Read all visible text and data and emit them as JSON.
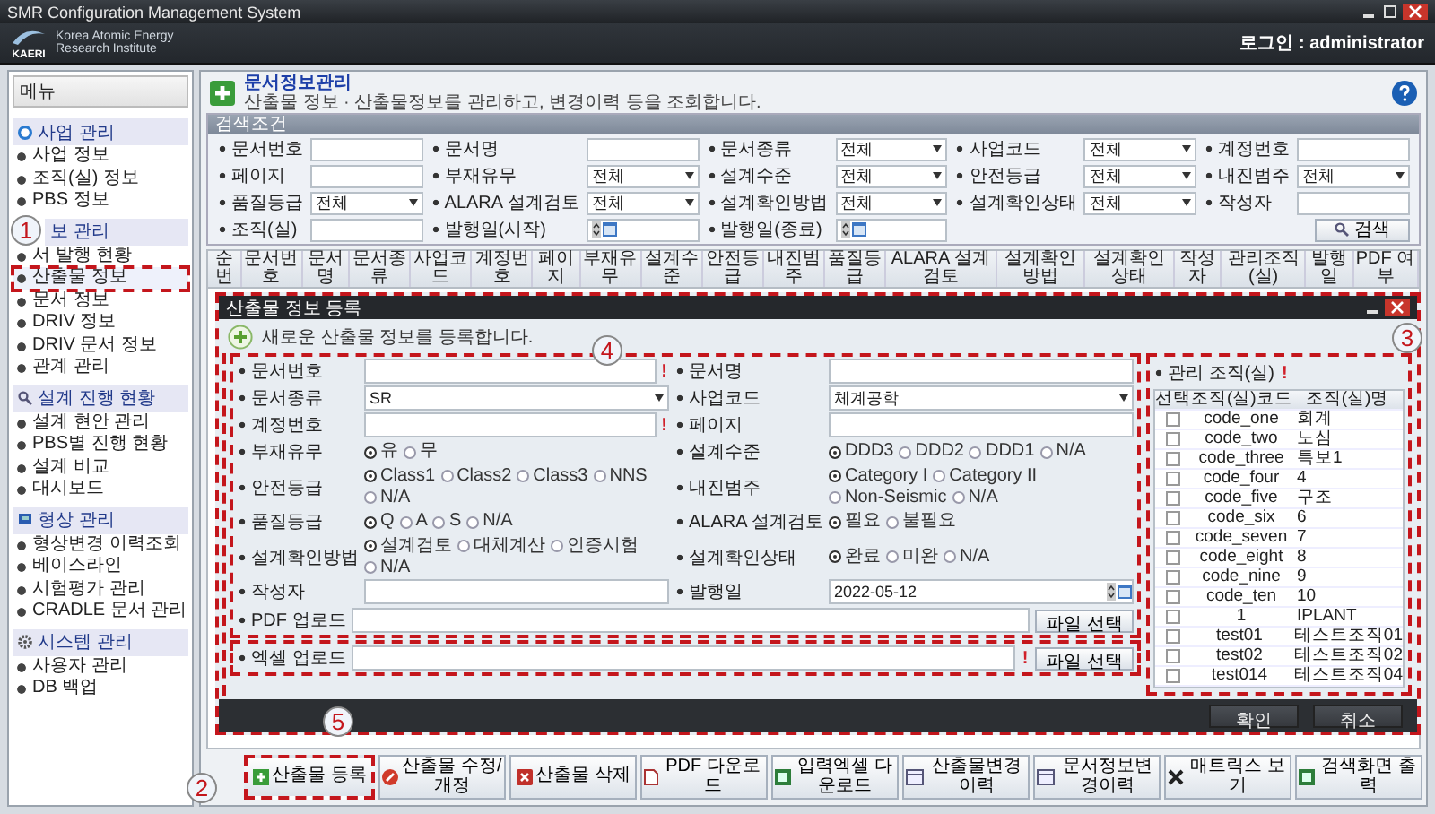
{
  "window": {
    "title": "SMR Configuration Management System"
  },
  "header": {
    "logo_text": "KAERI",
    "org": "Korea Atomic Energy Research Institute",
    "login": "로그인 : administrator"
  },
  "sidebar": {
    "title": "메뉴",
    "groups": [
      {
        "label": "사업 관리",
        "kind": "circle",
        "items": [
          {
            "label": "사업 정보",
            "selected": false,
            "highlighted": false
          },
          {
            "label": "조직(실) 정보",
            "selected": false,
            "highlighted": false
          },
          {
            "label": "PBS 정보",
            "selected": false,
            "highlighted": false
          }
        ]
      },
      {
        "label": "보 관리",
        "kind": "none",
        "items": [
          {
            "label": "서 발행 현황",
            "selected": false,
            "highlighted": false
          },
          {
            "label": "산출물 정보",
            "selected": true,
            "highlighted": true
          },
          {
            "label": "문서 정보",
            "selected": false,
            "highlighted": false
          },
          {
            "label": "DRIV 정보",
            "selected": false,
            "highlighted": false
          },
          {
            "label": "DRIV 문서 정보",
            "selected": false,
            "highlighted": false
          },
          {
            "label": "관계 관리",
            "selected": false,
            "highlighted": false
          }
        ]
      },
      {
        "label": "설계 진행 현황",
        "kind": "search",
        "items": [
          {
            "label": "설계 현안 관리",
            "selected": false,
            "highlighted": false
          },
          {
            "label": "PBS별 진행 현황",
            "selected": false,
            "highlighted": false
          },
          {
            "label": "설계 비교",
            "selected": false,
            "highlighted": false
          },
          {
            "label": "대시보드",
            "selected": false,
            "highlighted": false
          }
        ]
      },
      {
        "label": "형상 관리",
        "kind": "monitor",
        "items": [
          {
            "label": "형상변경 이력조회",
            "selected": false,
            "highlighted": false
          },
          {
            "label": "베이스라인",
            "selected": false,
            "highlighted": false
          },
          {
            "label": "시험평가 관리",
            "selected": false,
            "highlighted": false
          },
          {
            "label": "CRADLE 문서 관리",
            "selected": false,
            "highlighted": false
          }
        ]
      },
      {
        "label": "시스템 관리",
        "kind": "gear",
        "items": [
          {
            "label": "사용자 관리",
            "selected": false,
            "highlighted": false
          },
          {
            "label": "DB 백업",
            "selected": false,
            "highlighted": false
          }
        ]
      }
    ]
  },
  "page": {
    "title": "문서정보관리",
    "subtitle": "산출물 정보 · 산출물정보를 관리하고, 변경이력 등을 조회합니다."
  },
  "search": {
    "title": "검색조건",
    "button": "검색",
    "fields": [
      {
        "label": "문서번호",
        "kind": "text"
      },
      {
        "label": "문서명",
        "kind": "text"
      },
      {
        "label": "문서종류",
        "kind": "select",
        "value": "전체"
      },
      {
        "label": "사업코드",
        "kind": "select",
        "value": "전체"
      },
      {
        "label": "계정번호",
        "kind": "text"
      },
      {
        "label": "페이지",
        "kind": "text"
      },
      {
        "label": "부재유무",
        "kind": "select",
        "value": "전체"
      },
      {
        "label": "설계수준",
        "kind": "select",
        "value": "전체"
      },
      {
        "label": "안전등급",
        "kind": "select",
        "value": "전체"
      },
      {
        "label": "내진범주",
        "kind": "select",
        "value": "전체"
      },
      {
        "label": "품질등급",
        "kind": "select",
        "value": "전체"
      },
      {
        "label": "ALARA 설계검토",
        "kind": "select",
        "value": "전체"
      },
      {
        "label": "설계확인방법",
        "kind": "select",
        "value": "전체"
      },
      {
        "label": "설계확인상태",
        "kind": "select",
        "value": "전체"
      },
      {
        "label": "작성자",
        "kind": "text"
      },
      {
        "label": "조직(실)",
        "kind": "text"
      },
      {
        "label": "발행일(시작)",
        "kind": "date"
      },
      {
        "label": "발행일(종료)",
        "kind": "date"
      }
    ]
  },
  "table": {
    "columns": [
      "순번",
      "문서번호",
      "문서명",
      "문서종류",
      "사업코드",
      "계정번호",
      "페이지",
      "부재유무",
      "설계수준",
      "안전등급",
      "내진범주",
      "품질등급",
      "ALARA 설계검토",
      "설계확인방법",
      "설계확인상태",
      "작성자",
      "관리조직(실)",
      "발행일",
      "PDF 여부"
    ]
  },
  "dialog": {
    "title": "산출물 정보 등록",
    "intro": "새로운 산출물 정보를 등록합니다.",
    "left": [
      {
        "label": "문서번호",
        "kind": "text",
        "mark": "!"
      },
      {
        "label": "문서종류",
        "kind": "select",
        "value": "SR"
      },
      {
        "label": "계정번호",
        "kind": "text",
        "mark": "!"
      },
      {
        "label": "부재유무",
        "kind": "radio",
        "options": [
          {
            "label": "유",
            "selected": true
          },
          {
            "label": "무",
            "selected": false
          }
        ]
      },
      {
        "label": "안전등급",
        "kind": "radio",
        "options": [
          {
            "label": "Class1",
            "selected": true
          },
          {
            "label": "Class2",
            "selected": false
          },
          {
            "label": "Class3",
            "selected": false
          },
          {
            "label": "NNS",
            "selected": false
          },
          {
            "label": "N/A",
            "selected": false
          }
        ]
      },
      {
        "label": "품질등급",
        "kind": "radio",
        "options": [
          {
            "label": "Q",
            "selected": true
          },
          {
            "label": "A",
            "selected": false
          },
          {
            "label": "S",
            "selected": false
          },
          {
            "label": "N/A",
            "selected": false
          }
        ]
      },
      {
        "label": "설계확인방법",
        "kind": "radio",
        "options": [
          {
            "label": "설계검토",
            "selected": true
          },
          {
            "label": "대체계산",
            "selected": false
          },
          {
            "label": "인증시험",
            "selected": false
          },
          {
            "label": "N/A",
            "selected": false
          }
        ]
      },
      {
        "label": "작성자",
        "kind": "text"
      }
    ],
    "right": [
      {
        "label": "문서명",
        "kind": "text"
      },
      {
        "label": "사업코드",
        "kind": "select",
        "value": "체계공학"
      },
      {
        "label": "페이지",
        "kind": "text"
      },
      {
        "label": "설계수준",
        "kind": "radio",
        "options": [
          {
            "label": "DDD3",
            "selected": true
          },
          {
            "label": "DDD2",
            "selected": false
          },
          {
            "label": "DDD1",
            "selected": false
          },
          {
            "label": "N/A",
            "selected": false
          }
        ]
      },
      {
        "label": "내진범주",
        "kind": "radio",
        "options": [
          {
            "label": "Category I",
            "selected": true
          },
          {
            "label": "Category II",
            "selected": false
          },
          {
            "label": "Non-Seismic",
            "selected": false
          },
          {
            "label": "N/A",
            "selected": false
          }
        ]
      },
      {
        "label": "ALARA 설계검토",
        "kind": "radio",
        "options": [
          {
            "label": "필요",
            "selected": true
          },
          {
            "label": "불필요",
            "selected": false
          }
        ]
      },
      {
        "label": "설계확인상태",
        "kind": "radio",
        "options": [
          {
            "label": "완료",
            "selected": true
          },
          {
            "label": "미완",
            "selected": false
          },
          {
            "label": "N/A",
            "selected": false
          }
        ]
      },
      {
        "label": "발행일",
        "kind": "date",
        "value": "2022-05-12"
      }
    ],
    "uploads": [
      {
        "label": "PDF 업로드",
        "button": "파일 선택"
      },
      {
        "label": "엑셀 업로드",
        "mark": "!",
        "button": "파일 선택"
      }
    ],
    "org_panel": {
      "label": "관리 조직(실)",
      "mark": "!",
      "columns": [
        "선택",
        "조직(실)코드",
        "조직(실)명"
      ],
      "rows": [
        {
          "code": "code_one",
          "name": "회계",
          "checked": false
        },
        {
          "code": "code_two",
          "name": "노심",
          "checked": false
        },
        {
          "code": "code_three",
          "name": "특보1",
          "checked": false
        },
        {
          "code": "code_four",
          "name": "4",
          "checked": false
        },
        {
          "code": "code_five",
          "name": "구조",
          "checked": false
        },
        {
          "code": "code_six",
          "name": "6",
          "checked": false
        },
        {
          "code": "code_seven",
          "name": "7",
          "checked": false
        },
        {
          "code": "code_eight",
          "name": "8",
          "checked": false
        },
        {
          "code": "code_nine",
          "name": "9",
          "checked": false
        },
        {
          "code": "code_ten",
          "name": "10",
          "checked": false
        },
        {
          "code": "1",
          "name": "IPLANT",
          "checked": false
        },
        {
          "code": "test01",
          "name": "테스트조직01",
          "checked": false
        },
        {
          "code": "test02",
          "name": "테스트조직02",
          "checked": false
        },
        {
          "code": "test014",
          "name": "테스트조직04",
          "checked": false
        }
      ]
    },
    "buttons": [
      "확인",
      "취소"
    ]
  },
  "actions": [
    {
      "label": "산출물 등록",
      "kind": "add",
      "highlighted": true
    },
    {
      "label": "산출물 수정/개정",
      "kind": "edit",
      "highlighted": false
    },
    {
      "label": "산출물 삭제",
      "kind": "delete",
      "highlighted": false
    },
    {
      "label": "PDF 다운로드",
      "kind": "pdf",
      "highlighted": false
    },
    {
      "label": "입력엑셀 다운로드",
      "kind": "sheet",
      "highlighted": false
    },
    {
      "label": "산출물변경이력",
      "kind": "history",
      "highlighted": false
    },
    {
      "label": "문서정보변경이력",
      "kind": "history",
      "highlighted": false
    },
    {
      "label": "매트릭스 보기",
      "kind": "cross",
      "highlighted": false
    },
    {
      "label": "검색화면 출력",
      "kind": "sheet",
      "highlighted": false
    }
  ],
  "callouts": [
    {
      "number": "1"
    },
    {
      "number": "2"
    },
    {
      "number": "3"
    },
    {
      "number": "4"
    },
    {
      "number": "5"
    }
  ]
}
